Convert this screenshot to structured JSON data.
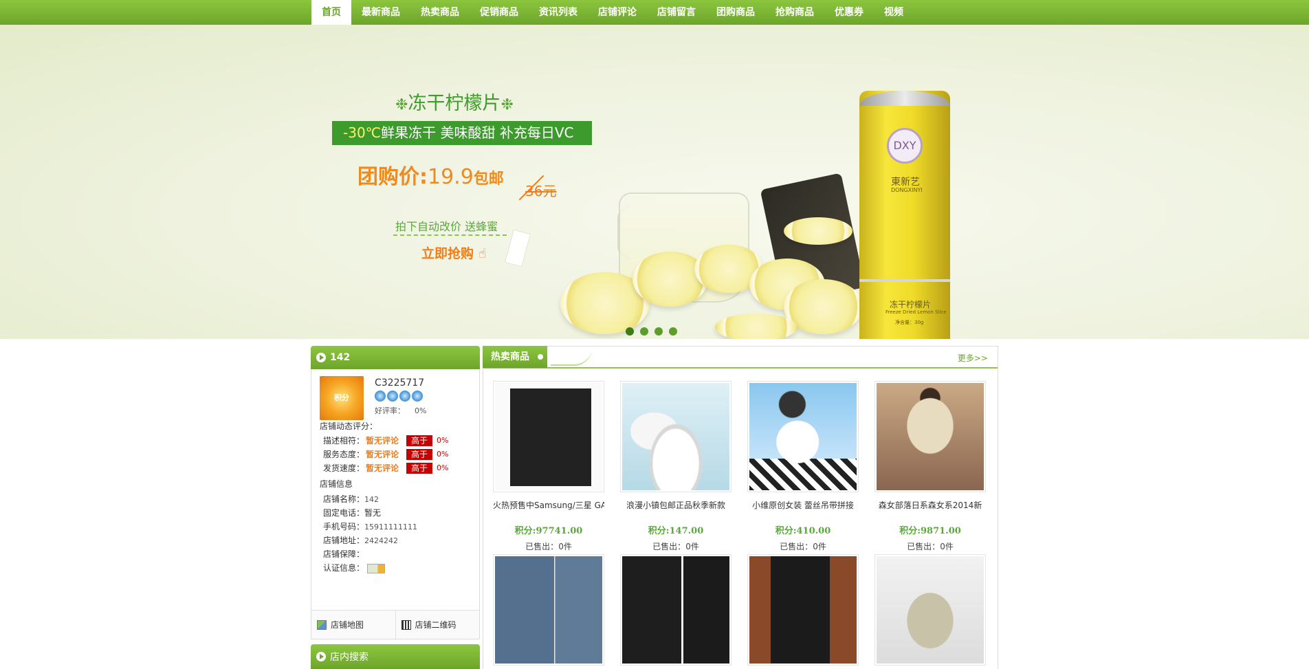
{
  "nav": {
    "items": [
      "首页",
      "最新商品",
      "热卖商品",
      "促销商品",
      "资讯列表",
      "店铺评论",
      "店铺留言",
      "团购商品",
      "抢购商品",
      "优惠券",
      "视频"
    ],
    "active_index": 0
  },
  "banner": {
    "title": "冻干柠檬片",
    "strip_temp": "-30℃",
    "strip_text": "鲜果冻干 美味酸甜 补充每日VC",
    "price_label": "团购价:",
    "price_value": "19.9",
    "price_ship": "包邮",
    "old_price": "36元",
    "gift": "拍下自动改价 送蜂蜜",
    "buy": "立即抢购",
    "can_logo": "DXY",
    "can_brand": "東新艺",
    "can_sub": "DONGXINYI",
    "can_name": "冻干柠檬片",
    "can_en": "Freeze Dried Lemon Slice",
    "can_net": "净含量：30g",
    "slide_count": 4,
    "active_slide": 0
  },
  "shop": {
    "header_title": "142",
    "avatar_text": "积分",
    "user_id": "C3225717",
    "stars": 4,
    "praise_label": "好评率：",
    "praise_value": "0%",
    "dynamic_label": "店铺动态评分：",
    "scores": [
      {
        "label": "描述相符：",
        "value": "暂无评论",
        "compare": "高于",
        "pct": "0%"
      },
      {
        "label": "服务态度：",
        "value": "暂无评论",
        "compare": "高于",
        "pct": "0%"
      },
      {
        "label": "发货速度：",
        "value": "暂无评论",
        "compare": "高于",
        "pct": "0%"
      }
    ],
    "info_label": "店铺信息",
    "info": [
      {
        "label": "店铺名称：",
        "value": "142"
      },
      {
        "label": "固定电话：",
        "value": "暂无"
      },
      {
        "label": "手机号码：",
        "value": "15911111111"
      },
      {
        "label": "店铺地址：",
        "value": "2424242"
      },
      {
        "label": "店铺保障：",
        "value": ""
      },
      {
        "label": "认证信息：",
        "value": ""
      }
    ],
    "map_link": "店铺地图",
    "qr_link": "店铺二维码",
    "search_title": "店内搜索"
  },
  "hot": {
    "title": "热卖商品",
    "more": "更多>>",
    "points_label": "积分:",
    "sold_label": "已售出：",
    "products": [
      {
        "name": "火热预售中Samsung/三星 GA",
        "points": "97741.00",
        "sold": "0件",
        "image": "phone"
      },
      {
        "name": "浪漫小镇包邮正品秋季新款",
        "points": "147.00",
        "sold": "0件",
        "image": "white-shoe"
      },
      {
        "name": "小维原创女装 蕾丝吊带拼接",
        "points": "410.00",
        "sold": "0件",
        "image": "girl-cap"
      },
      {
        "name": "森女部落日系森女系2014新",
        "points": "9871.00",
        "sold": "0件",
        "image": "beige-dress"
      },
      {
        "name": "",
        "points": "",
        "sold": "",
        "image": "jeans"
      },
      {
        "name": "",
        "points": "",
        "sold": "",
        "image": "black-pants"
      },
      {
        "name": "",
        "points": "",
        "sold": "",
        "image": "black-jeans"
      },
      {
        "name": "",
        "points": "",
        "sold": "",
        "image": "khaki-pants"
      }
    ]
  },
  "colors": {
    "nav_green": "#6da52a",
    "accent_orange": "#f07d16",
    "badge_red": "#c40000",
    "points_green": "#5aa83a"
  }
}
